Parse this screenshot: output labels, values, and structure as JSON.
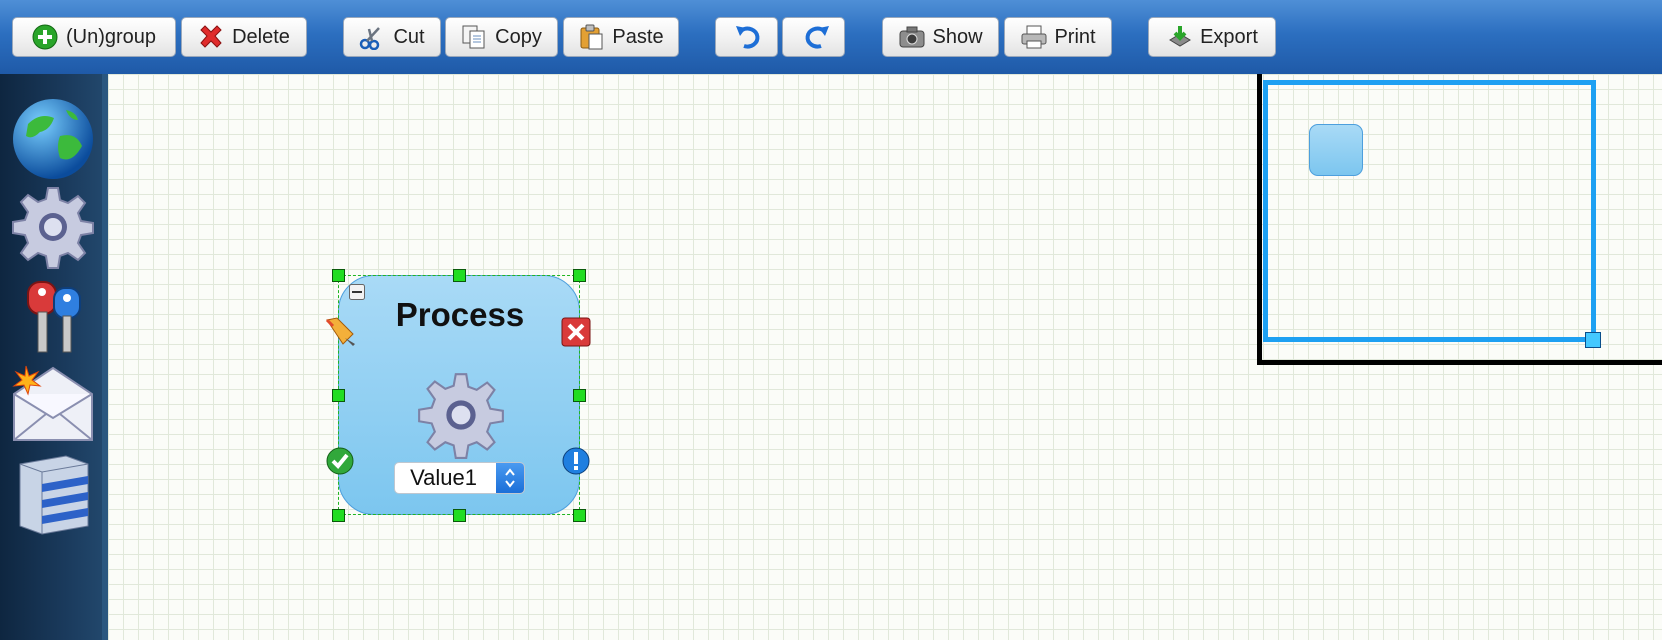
{
  "toolbar": {
    "ungroup_label": "(Un)group",
    "delete_label": "Delete",
    "cut_label": "Cut",
    "copy_label": "Copy",
    "paste_label": "Paste",
    "show_label": "Show",
    "print_label": "Print",
    "export_label": "Export"
  },
  "sidebar": {
    "items": [
      {
        "icon": "globe-icon"
      },
      {
        "icon": "gear-icon"
      },
      {
        "icon": "keys-icon"
      },
      {
        "icon": "mail-icon"
      },
      {
        "icon": "database-icon"
      }
    ]
  },
  "node": {
    "title": "Process",
    "value": "Value1"
  },
  "colors": {
    "toolbar": "#2c6fc0",
    "node_fill": "#7cc6ef",
    "selection": "#22dd22",
    "viewport": "#1ea0f2"
  }
}
